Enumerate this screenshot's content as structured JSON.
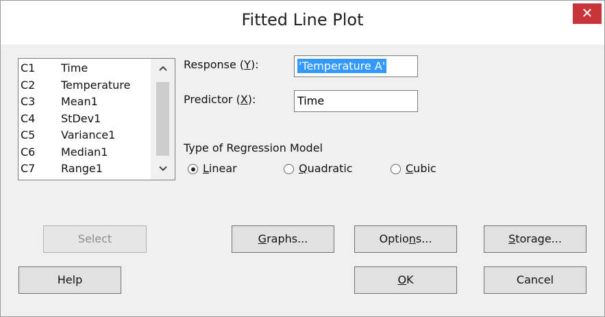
{
  "window": {
    "title": "Fitted Line Plot",
    "close_glyph": "✕"
  },
  "columns": [
    {
      "id": "C1",
      "name": "Time"
    },
    {
      "id": "C2",
      "name": "Temperature"
    },
    {
      "id": "C3",
      "name": "Mean1"
    },
    {
      "id": "C4",
      "name": "StDev1"
    },
    {
      "id": "C5",
      "name": "Variance1"
    },
    {
      "id": "C6",
      "name": "Median1"
    },
    {
      "id": "C7",
      "name": "Range1"
    }
  ],
  "scrollbar": {
    "up_glyph": "^",
    "down_glyph": "v"
  },
  "response": {
    "label_pre": "Response (",
    "label_key": "Y",
    "label_post": "):",
    "value": "'Temperature A'"
  },
  "predictor": {
    "label_pre": "Predictor (",
    "label_key": "X",
    "label_post": "):",
    "value": "Time"
  },
  "model": {
    "heading": "Type of Regression Model",
    "options": [
      {
        "pre": "",
        "key": "L",
        "post": "inear",
        "selected": true
      },
      {
        "pre": "",
        "key": "Q",
        "post": "uadratic",
        "selected": false
      },
      {
        "pre": "",
        "key": "C",
        "post": "ubic",
        "selected": false
      }
    ]
  },
  "buttons": {
    "select": {
      "label": "Select",
      "enabled": false
    },
    "graphs": {
      "pre": "",
      "key": "G",
      "post": "raphs..."
    },
    "options": {
      "pre": "Optio",
      "key": "n",
      "post": "s..."
    },
    "storage": {
      "pre": "",
      "key": "S",
      "post": "torage..."
    },
    "help": {
      "label": "Help"
    },
    "ok": {
      "pre": "",
      "key": "O",
      "post": "K"
    },
    "cancel": {
      "label": "Cancel"
    }
  }
}
